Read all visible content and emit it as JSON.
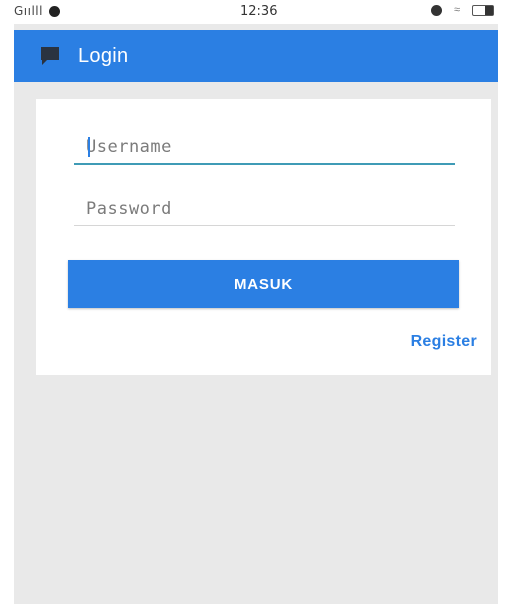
{
  "status_bar": {
    "carrier": "Gıılll",
    "time": "12:36",
    "icons": [
      "signal-bars-icon",
      "notification-icon",
      "alarm-icon",
      "wifi-icon",
      "battery-icon"
    ]
  },
  "app_bar": {
    "title": "Login",
    "icon": "chat-bubble-icon",
    "background_color": "#2b7fe3"
  },
  "form": {
    "username": {
      "placeholder": "Username",
      "value": "",
      "focused": true
    },
    "password": {
      "placeholder": "Password",
      "value": ""
    },
    "submit_label": "MASUK",
    "register_label": "Register"
  },
  "colors": {
    "accent": "#2b7fe3",
    "focus_underline": "#3f9bb6",
    "background": "#e9e9e9",
    "card": "#ffffff"
  }
}
